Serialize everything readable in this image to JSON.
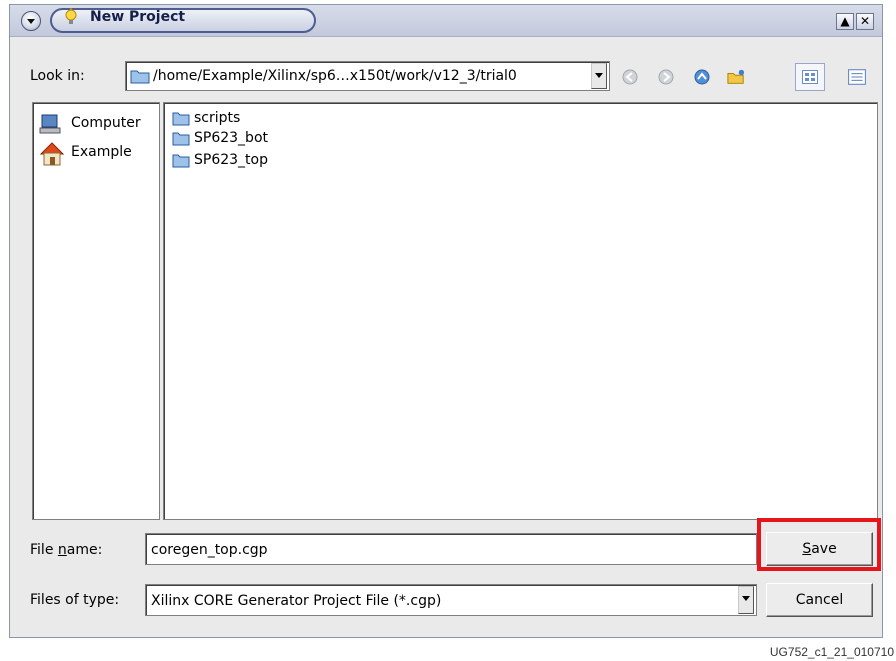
{
  "window": {
    "title": "New Project",
    "title_icon": "lightbulb-icon",
    "controls": [
      "maximize-icon",
      "close-icon"
    ]
  },
  "look_in": {
    "label": "Look in:",
    "path": "/home/Example/Xilinx/sp6…x150t/work/v12_3/trial0",
    "nav_icons": [
      "back-icon",
      "forward-icon",
      "up-folder-icon",
      "new-folder-icon",
      "list-view-icon",
      "details-view-icon"
    ]
  },
  "places": [
    {
      "label": "Computer",
      "icon": "computer-icon"
    },
    {
      "label": "Example",
      "icon": "home-icon"
    }
  ],
  "files": [
    {
      "name": "scripts",
      "icon": "folder-icon"
    },
    {
      "name": "SP623_bot",
      "icon": "folder-icon"
    },
    {
      "name": "SP623_top",
      "icon": "folder-icon"
    }
  ],
  "file_name": {
    "label_pre": "File ",
    "label_mnemonic": "n",
    "label_post": "ame:",
    "value": "coregen_top.cgp"
  },
  "file_type": {
    "label": "Files of type:",
    "value": "Xilinx CORE Generator Project File (*.cgp)"
  },
  "buttons": {
    "save_mnemonic": "S",
    "save_rest": "ave",
    "cancel": "Cancel"
  },
  "highlight_color": "#e8141c",
  "caption": "UG752_c1_21_010710"
}
